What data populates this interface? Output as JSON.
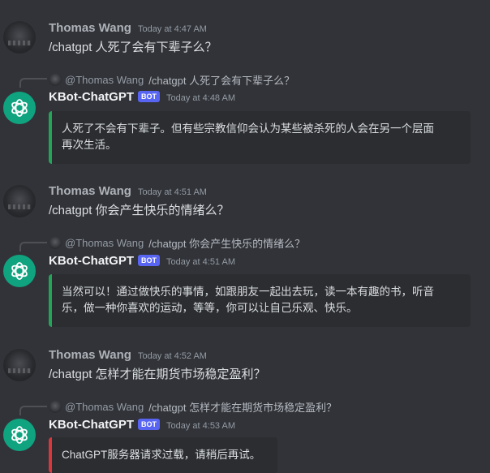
{
  "colors": {
    "ok": "#23a559",
    "error": "#da373c",
    "bot_tag": "#5865f2",
    "openai": "#10a37f"
  },
  "messages": [
    {
      "author": "Thomas Wang",
      "time": "Today at 4:47 AM",
      "text": "/chatgpt 人死了会有下辈子么？"
    },
    {
      "reply_to_user": "@Thomas Wang",
      "reply_to_text": "/chatgpt 人死了会有下辈子么？",
      "author": "KBot-ChatGPT",
      "bot_tag": "BOT",
      "time": "Today at 4:48 AM",
      "embed_lines": [
        "人死了不会有下辈子。但有些宗教信仰会认为某些被杀死的人会在另一个层面",
        "再次生活。"
      ]
    },
    {
      "author": "Thomas Wang",
      "time": "Today at 4:51 AM",
      "text": "/chatgpt 你会产生快乐的情绪么？"
    },
    {
      "reply_to_user": "@Thomas Wang",
      "reply_to_text": "/chatgpt 你会产生快乐的情绪么？",
      "author": "KBot-ChatGPT",
      "bot_tag": "BOT",
      "time": "Today at 4:51 AM",
      "embed_lines": [
        "当然可以！通过做快乐的事情，如跟朋友一起出去玩，读一本有趣的书，听音",
        "乐，做一种你喜欢的运动，等等，你可以让自己乐观、快乐。"
      ]
    },
    {
      "author": "Thomas Wang",
      "time": "Today at 4:52 AM",
      "text": "/chatgpt 怎样才能在期货市场稳定盈利？"
    },
    {
      "reply_to_user": "@Thomas Wang",
      "reply_to_text": "/chatgpt 怎样才能在期货市场稳定盈利？",
      "author": "KBot-ChatGPT",
      "bot_tag": "BOT",
      "time": "Today at 4:53 AM",
      "embed_lines": [
        "ChatGPT服务器请求过载，请稍后再试。"
      ]
    }
  ]
}
